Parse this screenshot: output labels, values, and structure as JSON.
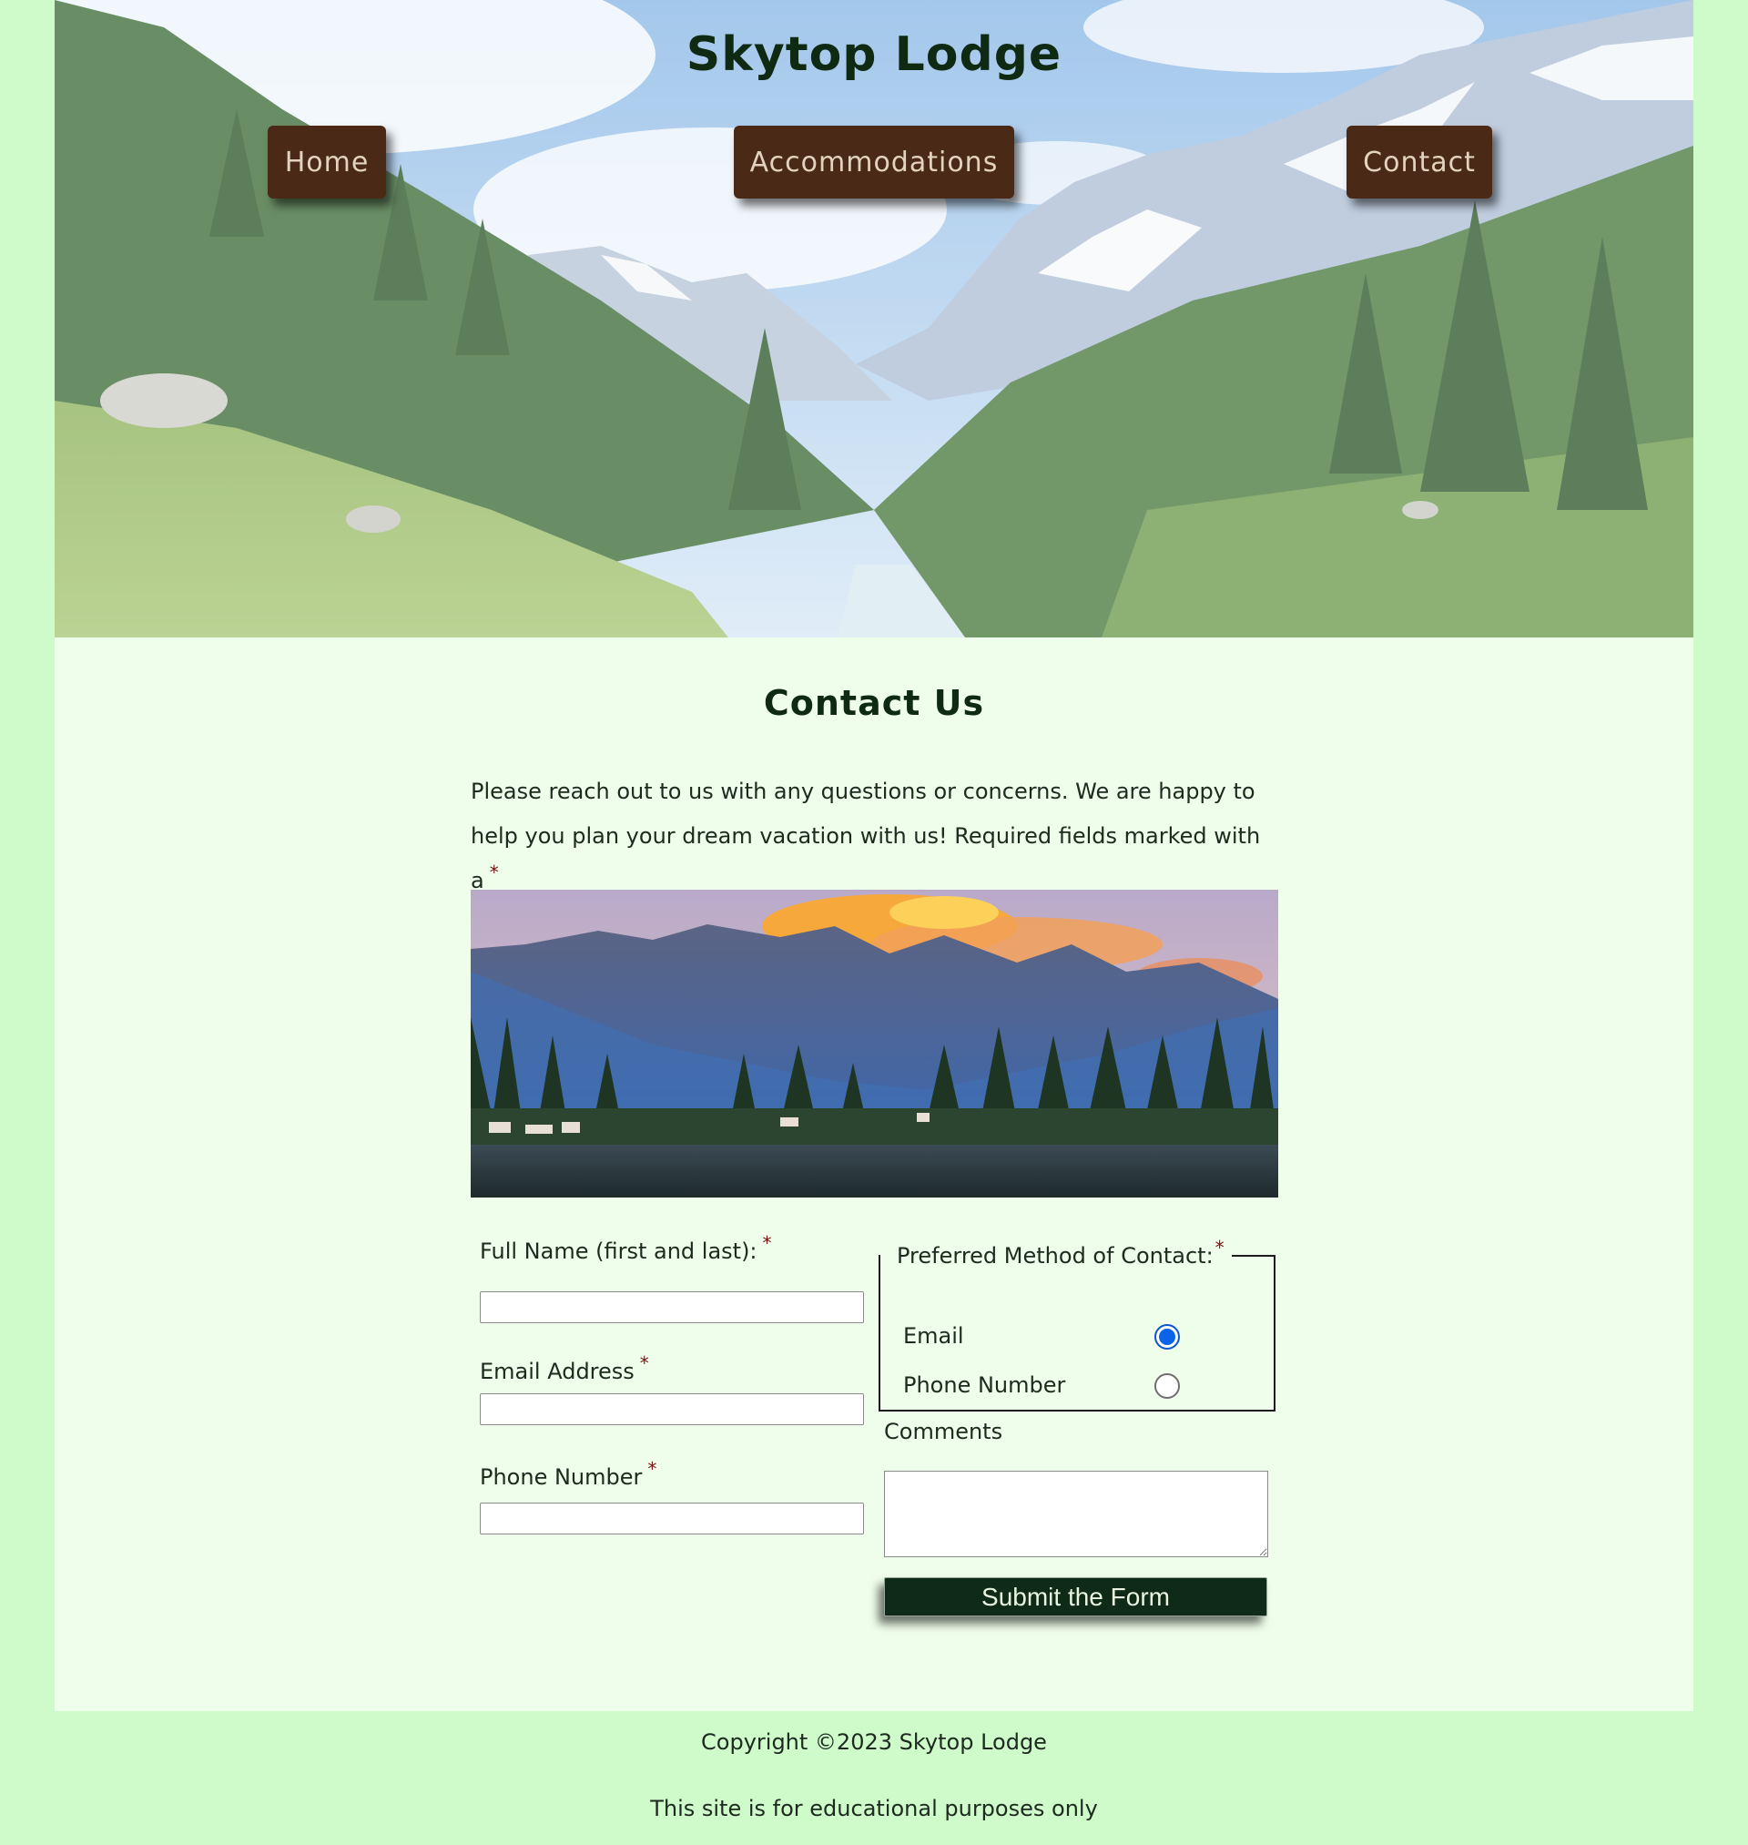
{
  "header": {
    "title": "Skytop Lodge",
    "nav": {
      "home": "Home",
      "accommodations": "Accommodations",
      "contact": "Contact"
    }
  },
  "main": {
    "heading": "Contact Us",
    "intro": "Please reach out to us with any questions or concerns. We are happy to help you plan your dream vacation with us! Required fields marked with a",
    "required_marker": "*"
  },
  "form": {
    "full_name_label": "Full Name (first and last):",
    "full_name_value": "",
    "email_label": "Email Address",
    "email_value": "",
    "phone_label": "Phone Number",
    "phone_value": "",
    "preferred_legend": "Preferred Method of Contact:",
    "option_email": "Email",
    "option_phone": "Phone Number",
    "selected_method": "Email",
    "comments_label": "Comments",
    "comments_value": "",
    "submit_label": "Submit the Form"
  },
  "footer": {
    "copyright": "Copyright ©2023 Skytop Lodge",
    "disclaimer": "This site is for educational purposes only"
  },
  "colors": {
    "page_background": "#cffac9",
    "content_background": "#effeea",
    "nav_button": "#4a2a16",
    "submit_button": "#0f2a16",
    "required_marker": "#7a1010",
    "radio_selected": "#0a63e8"
  }
}
